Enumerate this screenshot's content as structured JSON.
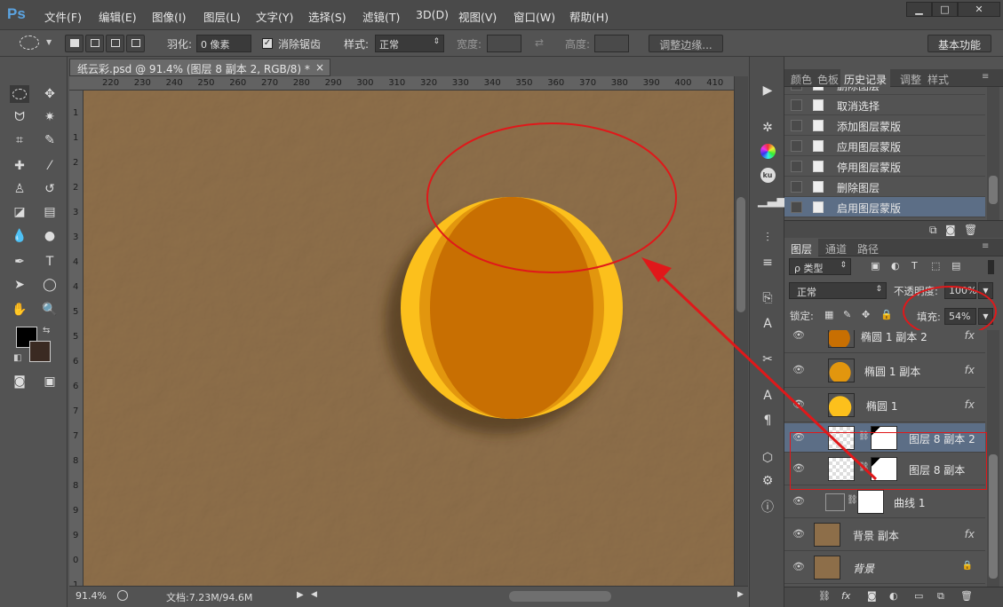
{
  "app": {
    "logo": "Ps"
  },
  "menu": [
    "文件(F)",
    "编辑(E)",
    "图像(I)",
    "图层(L)",
    "文字(Y)",
    "选择(S)",
    "滤镜(T)",
    "3D(D)",
    "视图(V)",
    "窗口(W)",
    "帮助(H)"
  ],
  "window_buttons": {
    "minimize": "▁",
    "maximize": "□",
    "close": "✕"
  },
  "options": {
    "feather_label": "羽化:",
    "feather_value": "0 像素",
    "antialias_label": "消除锯齿",
    "style_label": "样式:",
    "style_value": "正常",
    "width_label": "宽度:",
    "height_label": "高度:",
    "refine_edge_button": "调整边缘...",
    "workspace_button": "基本功能"
  },
  "document": {
    "tab_title": "纸云彩.psd @ 91.4% (图层 8 副本 2, RGB/8) *",
    "close_glyph": "×",
    "zoom": "91.4%",
    "doc_size": "文档:7.23M/94.6M"
  },
  "ruler": {
    "horizontal": [
      "220",
      "230",
      "240",
      "250",
      "260",
      "270",
      "280",
      "290",
      "300",
      "310",
      "320",
      "330",
      "340",
      "350",
      "360",
      "370",
      "380",
      "390",
      "400",
      "410"
    ],
    "vertical": [
      "1",
      "1",
      "2",
      "2",
      "3",
      "3",
      "4",
      "4",
      "5",
      "5",
      "6",
      "6",
      "7",
      "7",
      "8",
      "8",
      "9",
      "9",
      "0",
      "1"
    ]
  },
  "colors": {
    "canvas": "#8c6d48",
    "foreground": "#000000",
    "background": "#3a2a22",
    "highlight": "#e0181a",
    "selected_row": "#5c6e86"
  },
  "top_panel": {
    "tabs": [
      "颜色",
      "色板",
      "历史记录",
      "调整",
      "样式"
    ],
    "active_tab": "历史记录",
    "history": [
      "删除图层",
      "取消选择",
      "添加图层蒙版",
      "应用图层蒙版",
      "停用图层蒙版",
      "删除图层",
      "启用图层蒙版"
    ]
  },
  "layers_panel": {
    "tabs": [
      "图层",
      "通道",
      "路径"
    ],
    "filter_label": "ρ 类型",
    "blend_mode": "正常",
    "opacity_label": "不透明度:",
    "opacity_value": "100%",
    "lock_label": "锁定:",
    "fill_label": "填充:",
    "fill_value": "54%",
    "layers": [
      {
        "name": "椭圆 1 副本 2",
        "fx": "fx"
      },
      {
        "name": "椭圆 1 副本",
        "fx": "fx"
      },
      {
        "name": "椭圆 1",
        "fx": "fx"
      },
      {
        "name": "图层 8 副本 2",
        "fx": ""
      },
      {
        "name": "图层 8 副本",
        "fx": ""
      },
      {
        "name": "曲线 1",
        "fx": ""
      },
      {
        "name": "背景 副本",
        "fx": "fx"
      },
      {
        "name": "背景",
        "fx": ""
      }
    ]
  }
}
